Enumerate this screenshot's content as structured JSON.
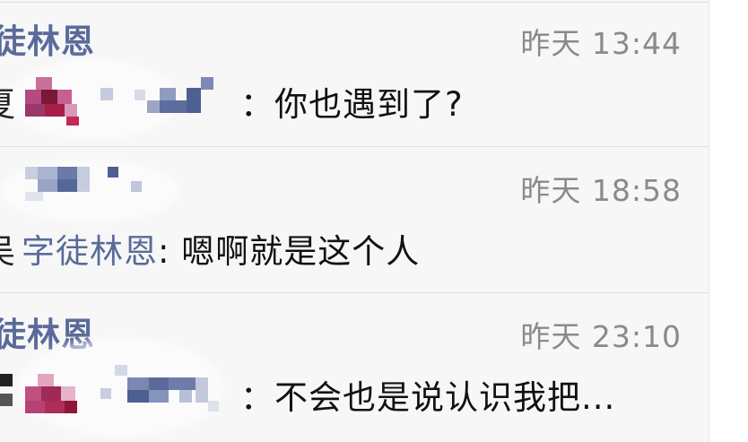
{
  "conversations": [
    {
      "sender_partial": "徒林恩",
      "time": "昨天 13:44",
      "preview_prefix_partial": "夏",
      "preview_text": "：你也遇到了?"
    },
    {
      "sender_partial": "",
      "time": "昨天 18:58",
      "preview_prefix_partial": "吴",
      "preview_name": "字徒林恩",
      "preview_text": ": 嗯啊就是这个人"
    },
    {
      "sender_partial": "徒林恩",
      "time": "昨天 23:10",
      "preview_prefix_partial": "",
      "preview_text": "：不会也是说认识我把..."
    }
  ]
}
